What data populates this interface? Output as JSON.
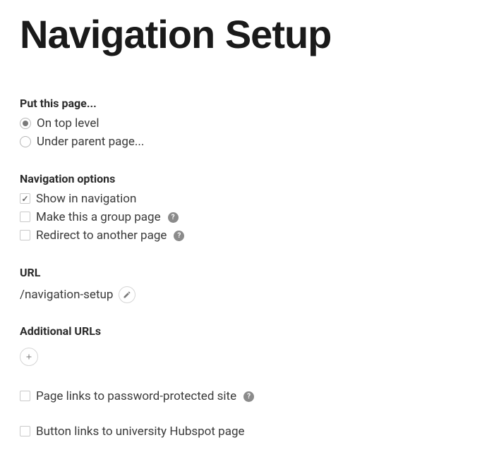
{
  "title": "Navigation Setup",
  "put_page": {
    "label": "Put this page...",
    "options": [
      {
        "label": "On top level",
        "selected": true
      },
      {
        "label": "Under parent page...",
        "selected": false
      }
    ]
  },
  "nav_options": {
    "label": "Navigation options",
    "items": [
      {
        "label": "Show in navigation",
        "checked": true,
        "help": false
      },
      {
        "label": "Make this a group page",
        "checked": false,
        "help": true
      },
      {
        "label": "Redirect to another page",
        "checked": false,
        "help": true
      }
    ]
  },
  "url": {
    "label": "URL",
    "value": "/navigation-setup"
  },
  "additional_urls": {
    "label": "Additional URLs"
  },
  "extra_checks": [
    {
      "label": "Page links to password-protected site",
      "checked": false,
      "help": true
    },
    {
      "label": "Button links to university Hubspot page",
      "checked": false,
      "help": false
    }
  ],
  "icons": {
    "help_glyph": "?"
  }
}
